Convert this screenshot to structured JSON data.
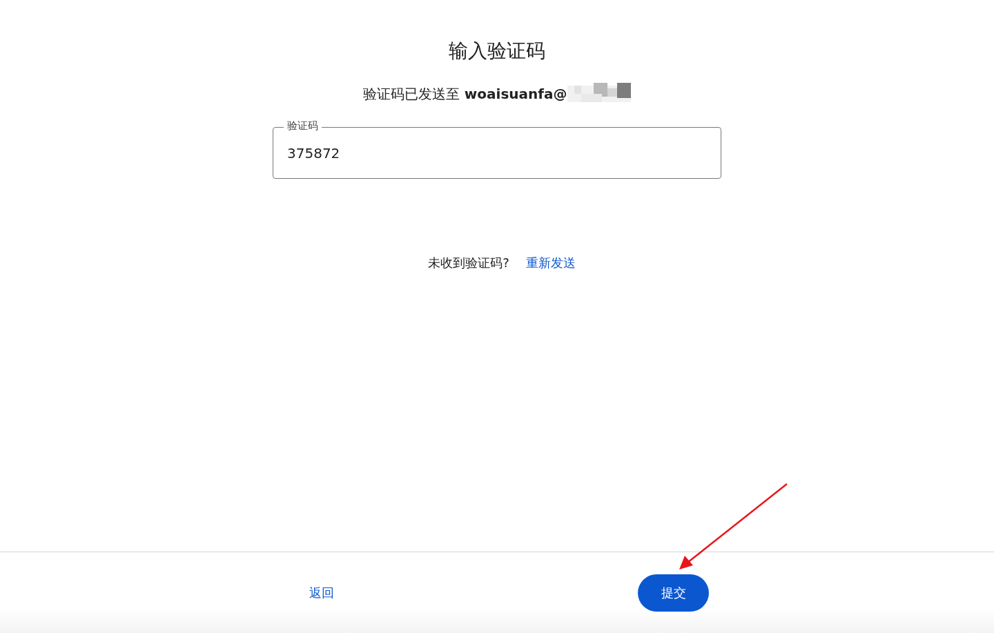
{
  "title": "输入验证码",
  "sent_notice": "验证码已发送至 **woaisuanfa@**",
  "code_field": {
    "label": "验证码",
    "value": "375872"
  },
  "resend": {
    "prompt": "未收到验证码?",
    "link": "重新发送"
  },
  "footer": {
    "back": "返回",
    "submit": "提交"
  }
}
